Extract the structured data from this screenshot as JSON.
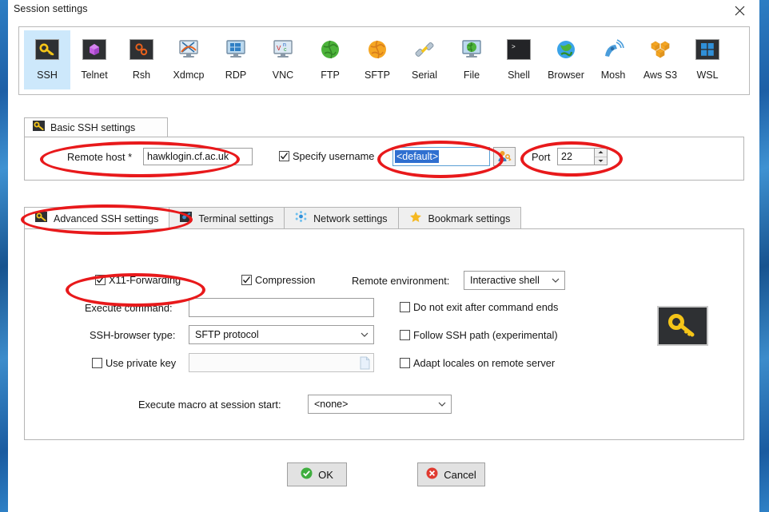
{
  "window": {
    "title": "Session settings",
    "close_icon": "close-icon"
  },
  "protocols": [
    {
      "label": "SSH",
      "icon": "key-icon",
      "selected": true
    },
    {
      "label": "Telnet",
      "icon": "telnet-icon",
      "selected": false
    },
    {
      "label": "Rsh",
      "icon": "gears-icon",
      "selected": false
    },
    {
      "label": "Xdmcp",
      "icon": "xdmcp-icon",
      "selected": false
    },
    {
      "label": "RDP",
      "icon": "rdp-icon",
      "selected": false
    },
    {
      "label": "VNC",
      "icon": "vnc-icon",
      "selected": false
    },
    {
      "label": "FTP",
      "icon": "globe-green-icon",
      "selected": false
    },
    {
      "label": "SFTP",
      "icon": "globe-orange-icon",
      "selected": false
    },
    {
      "label": "Serial",
      "icon": "serial-plug-icon",
      "selected": false
    },
    {
      "label": "File",
      "icon": "file-monitor-icon",
      "selected": false
    },
    {
      "label": "Shell",
      "icon": "terminal-icon",
      "selected": false
    },
    {
      "label": "Browser",
      "icon": "globe-blue-icon",
      "selected": false
    },
    {
      "label": "Mosh",
      "icon": "satellite-icon",
      "selected": false
    },
    {
      "label": "Aws S3",
      "icon": "aws-cubes-icon",
      "selected": false
    },
    {
      "label": "WSL",
      "icon": "windows-icon",
      "selected": false
    }
  ],
  "basic_group": {
    "tab_label": "Basic SSH settings",
    "tab_icon": "key-icon",
    "remote_host_label": "Remote host *",
    "remote_host_value": "hawklogin.cf.ac.uk",
    "specify_username_label": "Specify username",
    "specify_username_checked": true,
    "username_value": "<default>",
    "username_browse_icon": "user-key-icon",
    "port_label": "Port",
    "port_value": "22",
    "spinner_up_icon": "chevron-up-icon",
    "spinner_down_icon": "chevron-down-icon"
  },
  "tabs": [
    {
      "label": "Advanced SSH settings",
      "icon": "key-icon",
      "active": true
    },
    {
      "label": "Terminal settings",
      "icon": "terminal-blue-icon",
      "active": false
    },
    {
      "label": "Network settings",
      "icon": "network-dots-icon",
      "active": false
    },
    {
      "label": "Bookmark settings",
      "icon": "star-icon",
      "active": false
    }
  ],
  "advanced": {
    "x11_label": "X11-Forwarding",
    "x11_checked": true,
    "compression_label": "Compression",
    "compression_checked": true,
    "remote_env_label": "Remote environment:",
    "remote_env_value": "Interactive shell",
    "execute_command_label": "Execute command:",
    "execute_command_value": "",
    "no_exit_label": "Do not exit after command ends",
    "no_exit_checked": false,
    "browser_type_label": "SSH-browser type:",
    "browser_type_value": "SFTP protocol",
    "follow_path_label": "Follow SSH path (experimental)",
    "follow_path_checked": false,
    "private_key_label": "Use private key",
    "private_key_checked": false,
    "private_key_value": "",
    "adapt_locales_label": "Adapt locales on remote server",
    "adapt_locales_checked": false,
    "macro_label": "Execute macro at session start:",
    "macro_value": "<none>",
    "key_badge_icon": "key-icon",
    "chevron_icon": "chevron-down-icon"
  },
  "buttons": {
    "ok_label": "OK",
    "ok_icon": "check-circle-icon",
    "cancel_label": "Cancel",
    "cancel_icon": "x-circle-icon"
  },
  "annotations": {
    "color": "#e8191b",
    "shapes": [
      "ellipse-remote-host",
      "ellipse-username",
      "ellipse-port",
      "ellipse-advanced-ssh-tab",
      "ellipse-x11-forwarding"
    ]
  },
  "colors": {
    "selection_blue": "#cde8fb",
    "desktop_blue": "#1b5fa8",
    "annotation_red": "#e8191b",
    "text": "#161616"
  }
}
